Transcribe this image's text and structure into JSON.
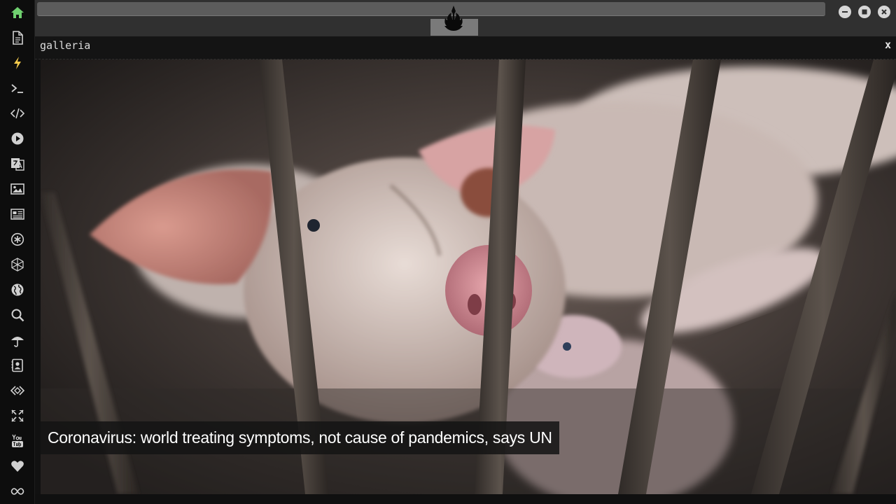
{
  "dock": {
    "items": [
      {
        "icon": "home-icon",
        "color": "#6fd06f"
      },
      {
        "icon": "document-icon",
        "color": "#d0d0d0"
      },
      {
        "icon": "lightning-icon",
        "color": "#f2c94c"
      },
      {
        "icon": "terminal-icon",
        "color": "#d0d0d0"
      },
      {
        "icon": "code-icon",
        "color": "#d0d0d0"
      },
      {
        "icon": "play-icon",
        "color": "#d0d0d0"
      },
      {
        "icon": "translate-icon",
        "color": "#d0d0d0"
      },
      {
        "icon": "image-icon",
        "color": "#d0d0d0"
      },
      {
        "icon": "news-icon",
        "color": "#d0d0d0"
      },
      {
        "icon": "asterisk-icon",
        "color": "#d0d0d0"
      },
      {
        "icon": "polyhedron-icon",
        "color": "#d0d0d0"
      },
      {
        "icon": "globe-icon",
        "color": "#d0d0d0"
      },
      {
        "icon": "search-icon",
        "color": "#d0d0d0"
      },
      {
        "icon": "umbrella-icon",
        "color": "#d0d0d0"
      },
      {
        "icon": "contact-icon",
        "color": "#d0d0d0"
      },
      {
        "icon": "embed-icon",
        "color": "#d0d0d0"
      },
      {
        "icon": "expand-icon",
        "color": "#d0d0d0"
      },
      {
        "icon": "youtube-icon",
        "color": "#d0d0d0"
      },
      {
        "icon": "heart-icon",
        "color": "#d0d0d0"
      },
      {
        "icon": "infinity-icon",
        "color": "#d0d0d0"
      }
    ]
  },
  "topbar": {
    "logo_icon": "rebel-alliance-icon",
    "window_buttons": [
      "minimize-icon",
      "maximize-icon",
      "close-icon"
    ]
  },
  "panel": {
    "title": "galleria",
    "close_label": "x"
  },
  "gallery": {
    "caption": "Coronavirus: world treating symptoms, not cause of pandemics, says UN"
  },
  "colors": {
    "accent_home": "#6fd06f",
    "accent_flash": "#f2c94c",
    "chrome": "#303030",
    "panel_bg": "#141414"
  }
}
